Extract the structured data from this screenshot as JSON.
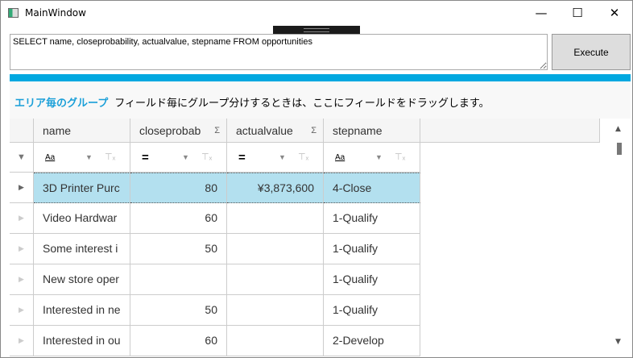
{
  "window": {
    "title": "MainWindow",
    "min": "—",
    "max": "☐",
    "close": "✕"
  },
  "query": {
    "text": "SELECT name, closeprobability, actualvalue, stepname FROM opportunities"
  },
  "execute_label": "Execute",
  "group_panel": {
    "title": "エリア毎のグループ",
    "hint": "フィールド毎にグループ分けするときは、ここにフィールドをドラッグします。"
  },
  "columns": [
    {
      "label": "name",
      "sigma": ""
    },
    {
      "label": "closeprobab",
      "sigma": "Σ"
    },
    {
      "label": "actualvalue",
      "sigma": "Σ"
    },
    {
      "label": "stepname",
      "sigma": ""
    }
  ],
  "filters": [
    "Aa",
    "=",
    "=",
    "Aa"
  ],
  "rows": [
    [
      "3D Printer Purc",
      "80",
      "¥3,873,600",
      "4-Close"
    ],
    [
      "Video Hardwar",
      "60",
      "",
      "1-Qualify"
    ],
    [
      "Some interest i",
      "50",
      "",
      "1-Qualify"
    ],
    [
      "New store oper",
      "",
      "",
      "1-Qualify"
    ],
    [
      "Interested in ne",
      "50",
      "",
      "1-Qualify"
    ],
    [
      "Interested in ou",
      "60",
      "",
      "2-Develop"
    ]
  ],
  "colors": {
    "accent": "#00a8e0",
    "selected": "#b3e0ef"
  }
}
